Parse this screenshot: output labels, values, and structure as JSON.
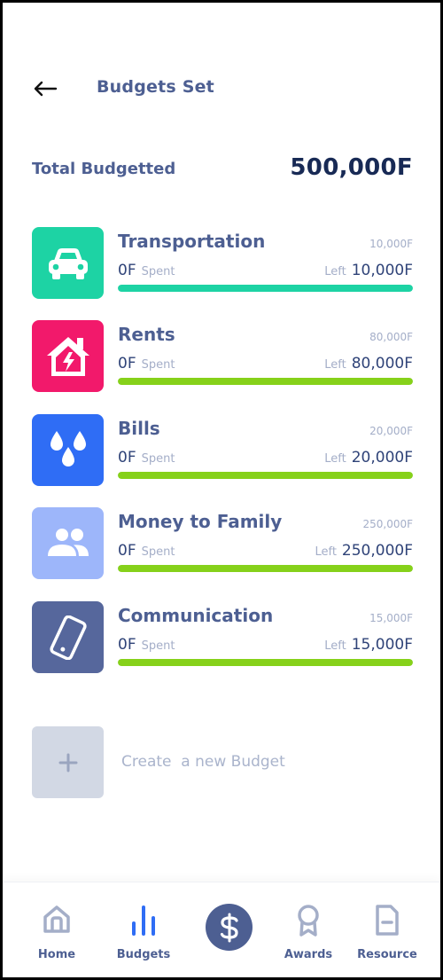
{
  "header": {
    "title": "Budgets Set"
  },
  "summary": {
    "label": "Total Budgetted",
    "value": "500,000F"
  },
  "budgets": [
    {
      "name": "Transportation",
      "total": "10,000F",
      "spent": "0F",
      "spent_label": "Spent",
      "left_label": "Left",
      "left": "10,000F",
      "icon": "car-icon",
      "tile_color": "#1dd3a4",
      "bar_color": "#1dd3a4",
      "bar_fill_fraction": 1.0
    },
    {
      "name": "Rents",
      "total": "80,000F",
      "spent": "0F",
      "spent_label": "Spent",
      "left_label": "Left",
      "left": "80,000F",
      "icon": "house-icon",
      "tile_color": "#f2196b",
      "bar_color": "#86d11a",
      "bar_fill_fraction": 1.0
    },
    {
      "name": "Bills",
      "total": "20,000F",
      "spent": "0F",
      "spent_label": "Spent",
      "left_label": "Left",
      "left": "20,000F",
      "icon": "water-drops-icon",
      "tile_color": "#2f6df5",
      "bar_color": "#86d11a",
      "bar_fill_fraction": 1.0
    },
    {
      "name": "Money to Family",
      "total": "250,000F",
      "spent": "0F",
      "spent_label": "Spent",
      "left_label": "Left",
      "left": "250,000F",
      "icon": "people-icon",
      "tile_color": "#9db6fa",
      "bar_color": "#86d11a",
      "bar_fill_fraction": 1.0
    },
    {
      "name": "Communication",
      "total": "15,000F",
      "spent": "0F",
      "spent_label": "Spent",
      "left_label": "Left",
      "left": "15,000F",
      "icon": "phone-icon",
      "tile_color": "#56679c",
      "bar_color": "#86d11a",
      "bar_fill_fraction": 1.0
    }
  ],
  "create": {
    "label": "Create  a new Budget",
    "icon": "plus-icon"
  },
  "nav": {
    "items": [
      {
        "label": "Home",
        "icon": "home-icon"
      },
      {
        "label": "Budgets",
        "icon": "bar-chart-icon",
        "active": true
      },
      {
        "label": "",
        "icon": "dollar-icon"
      },
      {
        "label": "Awards",
        "icon": "award-icon"
      },
      {
        "label": "Resource",
        "icon": "document-icon"
      }
    ]
  },
  "colors": {
    "primary": "#4d5f92",
    "dark_text": "#182a55",
    "muted": "#a4aec8",
    "active_nav": "#2f6df5"
  }
}
